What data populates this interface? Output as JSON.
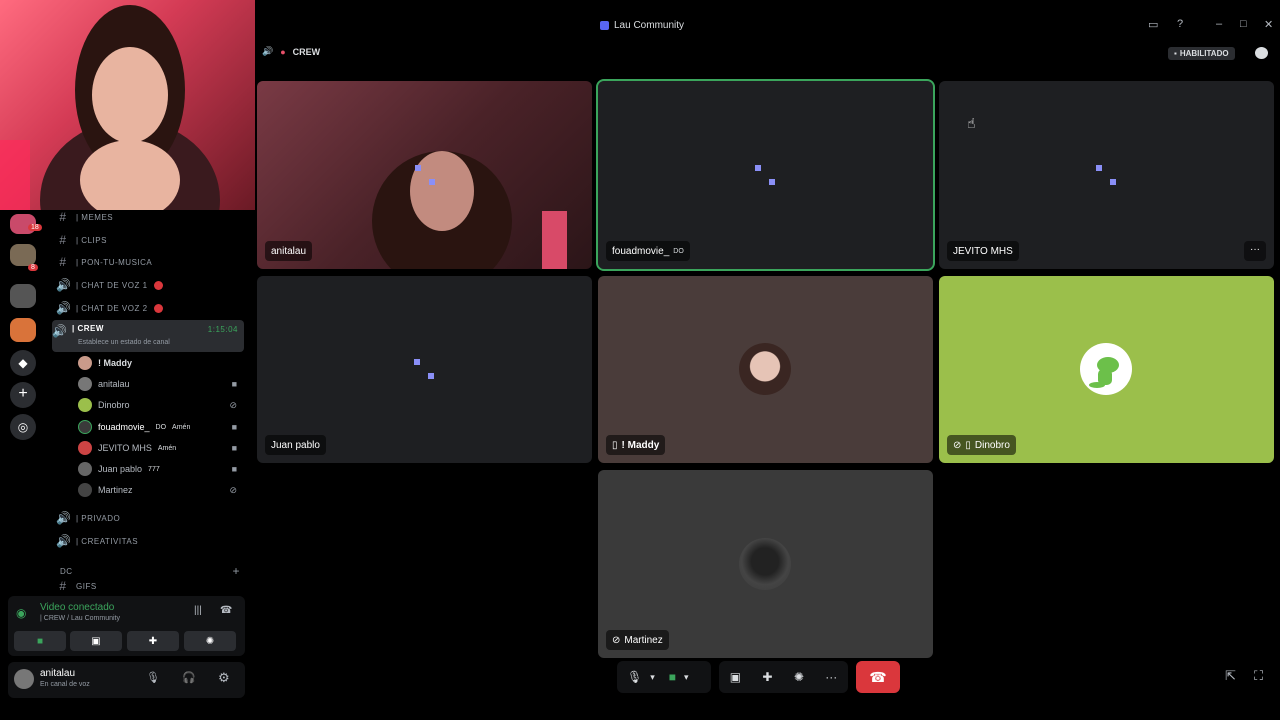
{
  "window": {
    "title": "Lau Community"
  },
  "call": {
    "channel": "CREW",
    "status_badge": "HABILITADO"
  },
  "tiles": [
    {
      "name": "anitalau"
    },
    {
      "name": "fouadmovie_",
      "tag": "DO"
    },
    {
      "name": "JEVITO MHS"
    },
    {
      "name": "Juan pablo"
    },
    {
      "name": "! Maddy"
    },
    {
      "name": "Dinobro"
    },
    {
      "name": "Martinez"
    }
  ],
  "sidebar": {
    "badges": [
      "18",
      "8"
    ],
    "channels": [
      {
        "label": "| MEMES"
      },
      {
        "label": "| CLIPS"
      },
      {
        "label": "| PON-TU-MUSICA"
      },
      {
        "label": "| CHAT DE VOZ 1"
      },
      {
        "label": "| CHAT DE VOZ 2"
      },
      {
        "label": "| CREW",
        "timer": "1:15:04",
        "status": "Establece un estado de canal"
      },
      {
        "label": "| PRIVADO"
      },
      {
        "label": "| CREATIVITAS"
      }
    ],
    "members": [
      {
        "name": "! Maddy"
      },
      {
        "name": "anitalau"
      },
      {
        "name": "Dinobro"
      },
      {
        "name": "fouadmovie_",
        "tag1": "DO",
        "tag2": "Amén"
      },
      {
        "name": "JEVITO MHS",
        "tag2": "Amén"
      },
      {
        "name": "Juan pablo",
        "tag2": "777"
      },
      {
        "name": "Martinez"
      }
    ],
    "category": "DC",
    "gifs": "GIFS",
    "voice": {
      "status": "Video conectado",
      "sub": "| CREW / Lau Community"
    },
    "user": {
      "name": "anitalau",
      "status": "En canal de voz"
    }
  },
  "colors": {
    "speaking": "#3ba55c",
    "hangup": "#da373c",
    "dinobg": "#9bbf4b"
  }
}
